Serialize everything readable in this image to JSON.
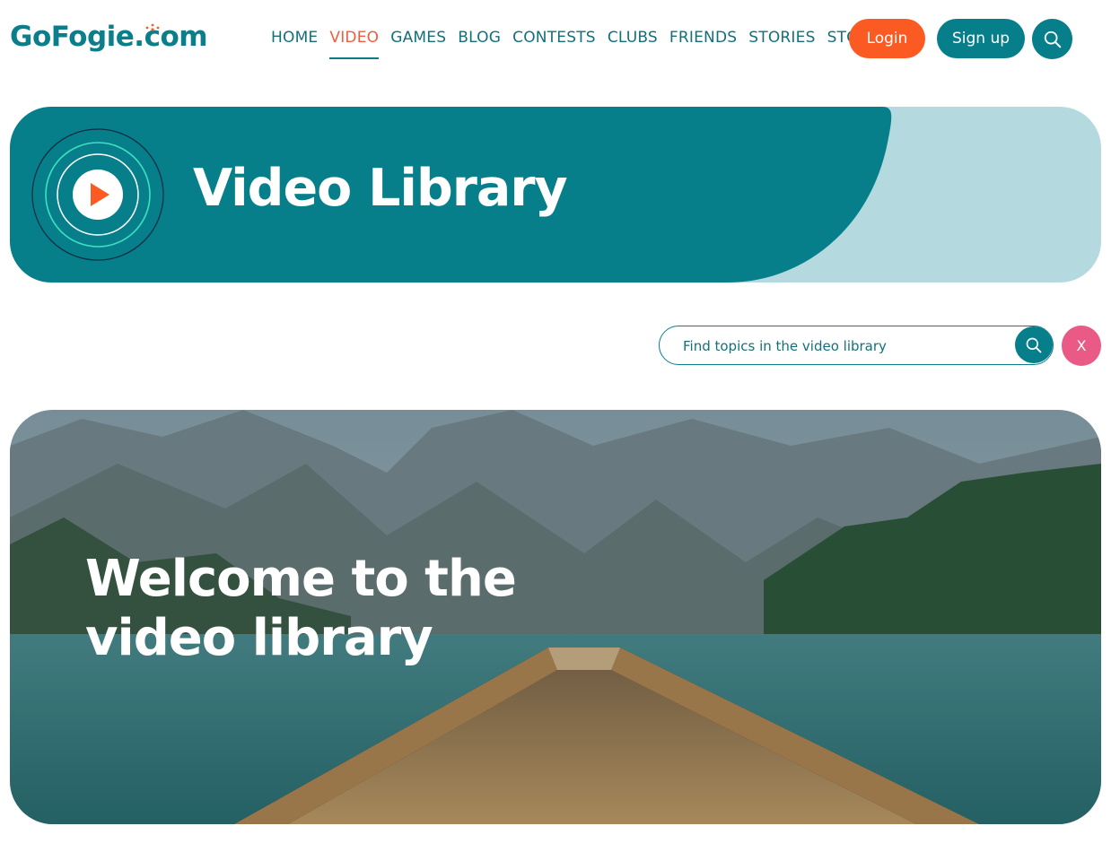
{
  "brand": {
    "logo_text": "GoFogie.com"
  },
  "nav": {
    "items": [
      {
        "label": "HOME"
      },
      {
        "label": "VIDEO"
      },
      {
        "label": "GAMES"
      },
      {
        "label": "BLOG"
      },
      {
        "label": "CONTESTS"
      },
      {
        "label": "CLUBS"
      },
      {
        "label": "FRIENDS"
      },
      {
        "label": "STORIES"
      },
      {
        "label": "STORE"
      }
    ],
    "active": "VIDEO"
  },
  "header": {
    "login_label": "Login",
    "signup_label": "Sign up"
  },
  "banner": {
    "title": "Video Library"
  },
  "search": {
    "placeholder": "Find topics in the video library",
    "clear_label": "X"
  },
  "hero": {
    "title": "Welcome to the\nvideo library"
  },
  "colors": {
    "teal": "#077f8a",
    "light_teal": "#b4dadf",
    "orange": "#fb5a23",
    "pink": "#ea5a86",
    "active_nav": "#f25c3a"
  }
}
